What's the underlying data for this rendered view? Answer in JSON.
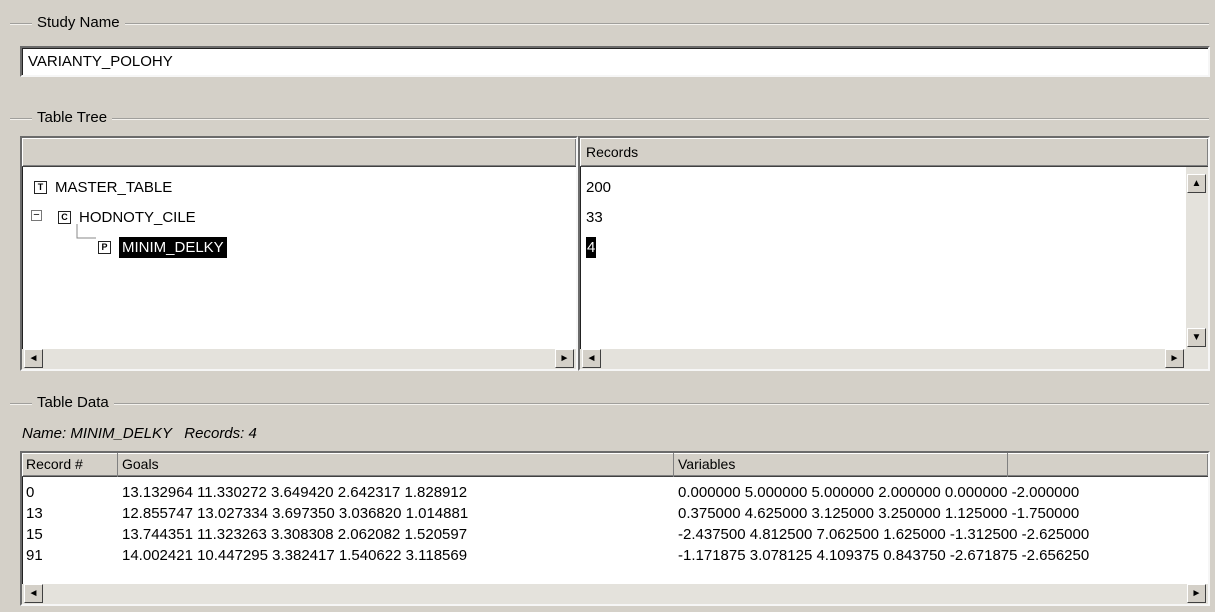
{
  "study": {
    "group_label": "Study Name",
    "name_value": "VARIANTY_POLOHY"
  },
  "tree": {
    "group_label": "Table Tree",
    "name_header": "",
    "records_header": "Records",
    "nodes": [
      {
        "label": "MASTER_TABLE",
        "icon_letter": "T",
        "records": "200"
      },
      {
        "label": "HODNOTY_CILE",
        "icon_letter": "C",
        "records": "33"
      },
      {
        "label": "MINIM_DELKY",
        "icon_letter": "P",
        "records": "4"
      }
    ]
  },
  "data": {
    "group_label": "Table Data",
    "name_label": "Name:",
    "name_value": "MINIM_DELKY",
    "records_label": "Records:",
    "records_value": "4",
    "headers": {
      "record": "Record #",
      "goals": "Goals",
      "variables": "Variables",
      "extra": ""
    },
    "rows": [
      {
        "record": "0",
        "goals": "13.132964  11.330272  3.649420  2.642317  1.828912",
        "variables": "0.000000  5.000000  5.000000  2.000000  0.000000  -2.000000"
      },
      {
        "record": "13",
        "goals": "12.855747  13.027334  3.697350  3.036820  1.014881",
        "variables": "0.375000  4.625000  3.125000  3.250000  1.125000  -1.750000"
      },
      {
        "record": "15",
        "goals": "13.744351  11.323263  3.308308  2.062082  1.520597",
        "variables": "-2.437500  4.812500  7.062500  1.625000  -1.312500  -2.625000"
      },
      {
        "record": "91",
        "goals": "14.002421  10.447295  3.382417  1.540622  3.118569",
        "variables": "-1.171875  3.078125  4.109375  0.843750  -2.671875  -2.656250"
      }
    ]
  },
  "icons": {
    "scroll_left": "◄",
    "scroll_right": "►",
    "scroll_up": "▲",
    "scroll_down": "▼",
    "collapse": "−"
  }
}
